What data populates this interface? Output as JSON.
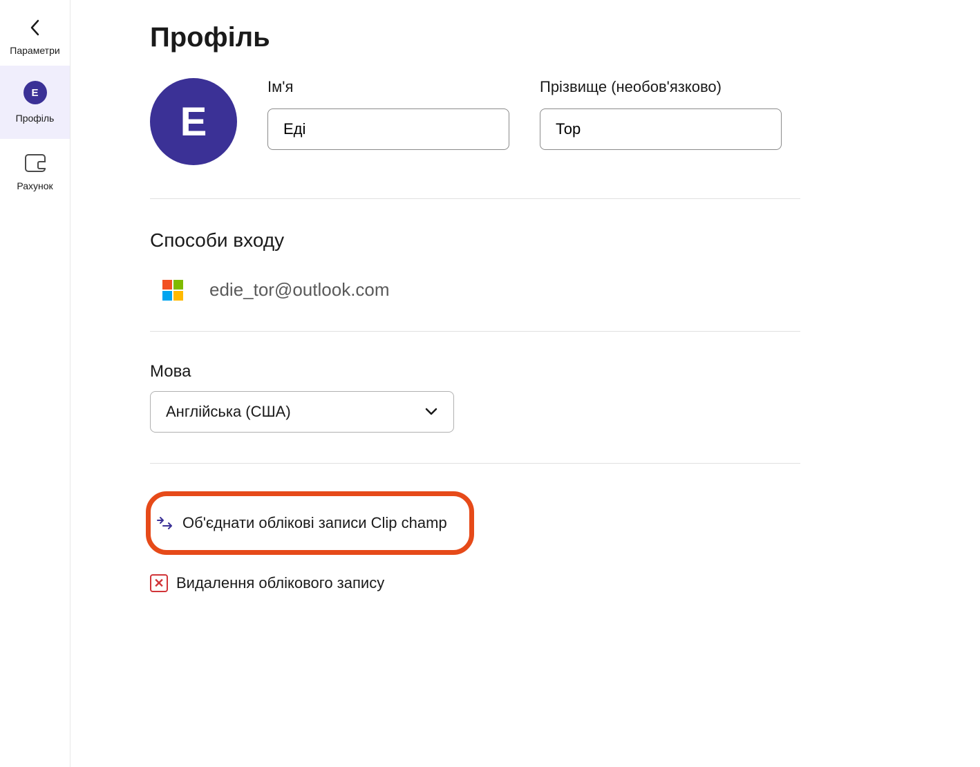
{
  "sidebar": {
    "back_label": "Параметри",
    "items": [
      {
        "label": "Профіль",
        "avatar_initial": "E"
      },
      {
        "label": "Рахунок"
      }
    ]
  },
  "page": {
    "title": "Профіль",
    "avatar_initial": "E"
  },
  "profile_form": {
    "first_name_label": "Ім'я",
    "first_name_value": "Еді",
    "last_name_label": "Прізвище (необов'язково)",
    "last_name_value": "Тор"
  },
  "login_methods": {
    "title": "Способи входу",
    "email": "edie_tor@outlook.com"
  },
  "language": {
    "label": "Мова",
    "selected": "Англійська (США)"
  },
  "actions": {
    "merge_label": "Об'єднати облікові записи Clip champ",
    "delete_label": "Видалення облікового запису"
  }
}
